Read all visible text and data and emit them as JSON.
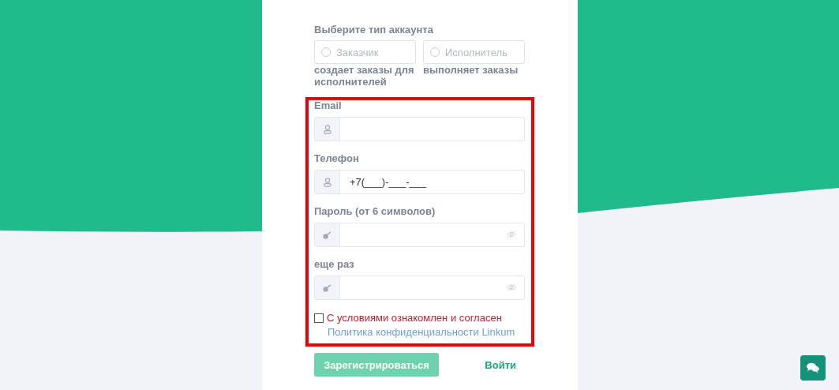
{
  "account_type": {
    "label": "Выберите тип аккаунта",
    "options": [
      {
        "label": "Заказчик",
        "description": "создает заказы для исполнителей",
        "selected": false
      },
      {
        "label": "Исполнитель",
        "description": "выполняет заказы",
        "selected": false
      }
    ]
  },
  "fields": [
    {
      "kind": "text",
      "label": "Email"
    },
    {
      "kind": "text",
      "label": "Телефон",
      "value": "+7(___)-___-___"
    },
    {
      "kind": "password",
      "label": "Пароль (от 6 символов)"
    },
    {
      "kind": "password",
      "label": "еще раз"
    }
  ],
  "agreement": {
    "text": "С условиями ознакомлен и согласен",
    "checked": false
  },
  "privacy_link": "Политика конфиденциальности Linkum",
  "register_button": {
    "label": "Зарегистрироваться",
    "disabled": true
  },
  "login_link": "Войти"
}
